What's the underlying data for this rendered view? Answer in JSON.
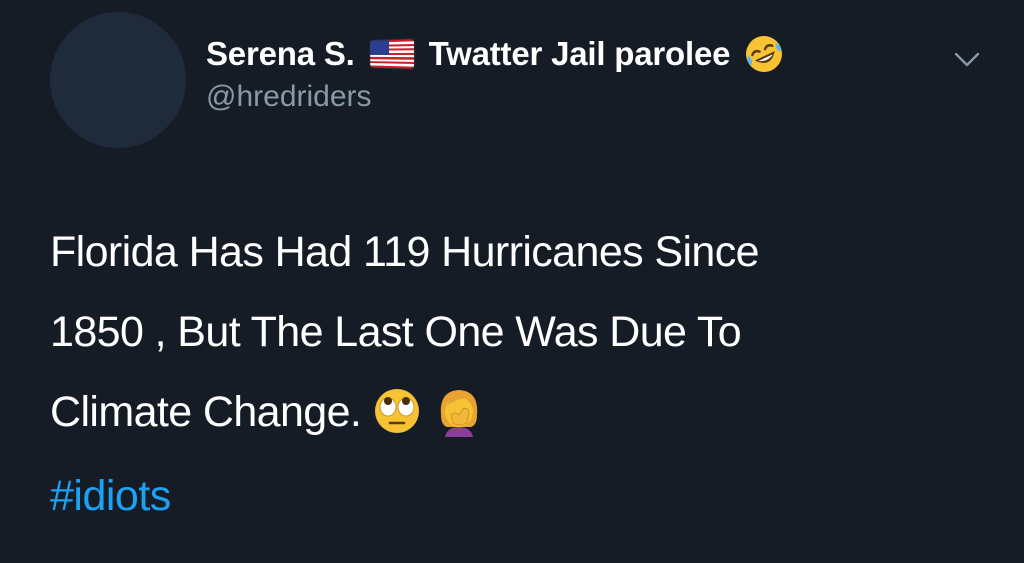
{
  "tweet": {
    "display_name": "Serena S.",
    "name_suffix": "Twatter Jail parolee",
    "handle": "@hredriders",
    "text_lines": [
      "Florida Has Had 119 Hurricanes Since",
      "1850 , But The Last One Was Due To",
      "Climate Change."
    ],
    "hashtag": "#idiots"
  },
  "icons": {
    "name_flag": "us-flag-icon",
    "name_emoji": "rolling-on-floor-laughing-icon",
    "menu": "chevron-down-icon",
    "text_emojis": [
      "face-with-rolling-eyes-icon",
      "woman-facepalming-icon"
    ]
  },
  "colors": {
    "background": "#151c26",
    "text": "#ffffff",
    "handle": "#8899a6",
    "hashtag": "#1da1f2"
  }
}
